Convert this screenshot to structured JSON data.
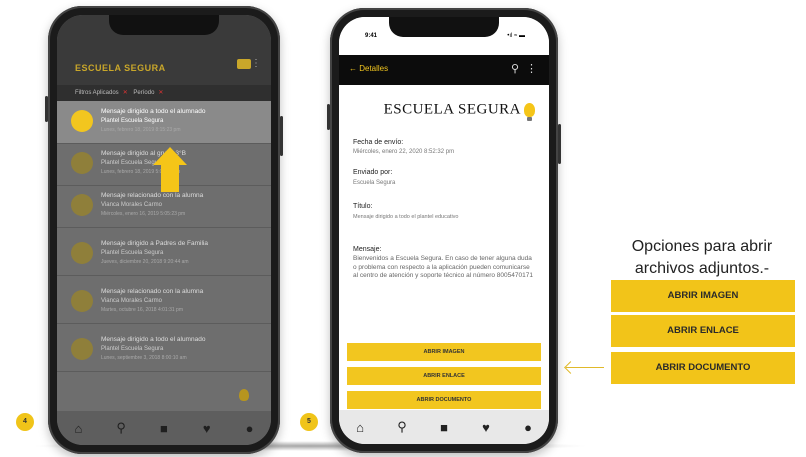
{
  "left_phone": {
    "app_title": "ESCUELA SEGURA",
    "filters": [
      "Filtros Aplicados",
      "Período"
    ],
    "messages": [
      {
        "title": "Mensaje dirigido a todo el alumnado",
        "sender": "Plantel Escuela Segura",
        "meta": "Lunes, febrero 18, 2019 8:15:23 pm"
      },
      {
        "title": "Mensaje dirigido al grupo 3°B",
        "sender": "Plantel Escuela Segura",
        "meta": "Lunes, febrero 18, 2019 5:08:11 pm"
      },
      {
        "title": "Mensaje relacionado con la alumna",
        "sender": "Vianca Morales Carmo",
        "meta": "Miércoles, enero 16, 2019 5:05:23 pm"
      },
      {
        "title": "Mensaje dirigido a Padres de Familia",
        "sender": "Plantel Escuela Segura",
        "meta": "Jueves, diciembre 20, 2018 9:20:44 am"
      },
      {
        "title": "Mensaje relacionado con la alumna",
        "sender": "Vianca Morales Carmo",
        "meta": "Martes, octubre 16, 2018 4:01:31 pm"
      },
      {
        "title": "Mensaje dirigido a todo el alumnado",
        "sender": "Plantel Escuela Segura",
        "meta": "Lunes, septiembre 3, 2018 8:00:10 am"
      }
    ],
    "step": "4"
  },
  "right_phone": {
    "status_time": "9:41",
    "status_signal": "•ıl ≈ ▬",
    "back_label": "← Detalles",
    "logo_text": "ESCUELA SEGURA",
    "sent_date_label": "Fecha de envío:",
    "sent_date_value": "Miércoles, enero 22, 2020 8:52:32 pm",
    "sent_by_label": "Enviado por:",
    "sent_by_value": "Escuela Segura",
    "title_label": "Título:",
    "title_value": "Mensaje dirigido a todo el plantel educativo",
    "message_label": "Mensaje:",
    "message_value": "Bienvenidos a Escuela Segura. En caso de tener alguna duda o problema con respecto a la aplicación pueden comunicarse al centro de atención y soporte técnico al número 8005470171",
    "btn_image": "ABRIR IMAGEN",
    "btn_link": "ABRIR ENLACE",
    "btn_document": "ABRIR DOCUMENTO",
    "step": "5"
  },
  "options_panel": {
    "title": "Opciones para abrir archivos adjuntos.-",
    "buttons": [
      "ABRIR IMAGEN",
      "ABRIR ENLACE",
      "ABRIR DOCUMENTO"
    ]
  },
  "nav_icons": [
    "home-icon",
    "search-icon",
    "grid-icon",
    "heart-icon",
    "profile-icon"
  ],
  "colors": {
    "accent_yellow": "#F2C419",
    "dark": "#0C0C0C"
  }
}
